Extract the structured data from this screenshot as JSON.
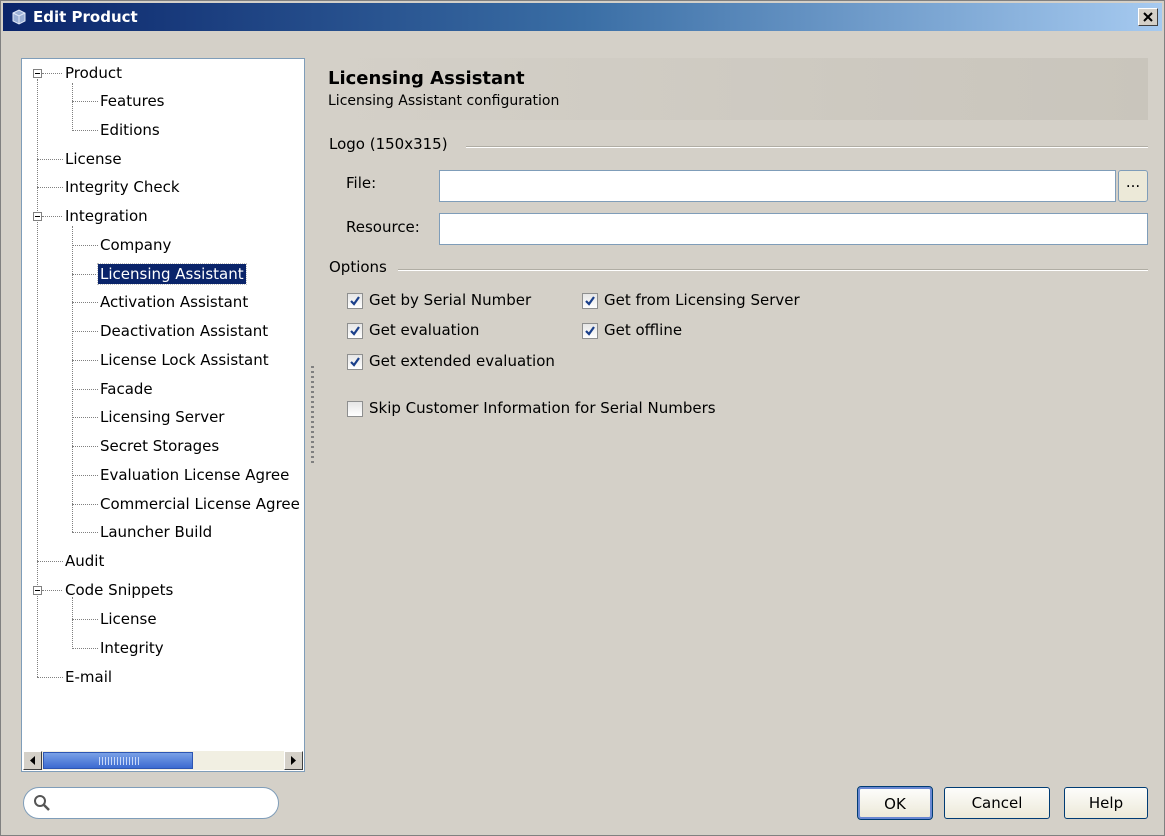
{
  "window": {
    "title": "Edit Product"
  },
  "tree": {
    "items": [
      {
        "label": "Product"
      },
      {
        "label": "Features"
      },
      {
        "label": "Editions"
      },
      {
        "label": "License"
      },
      {
        "label": "Integrity Check"
      },
      {
        "label": "Integration"
      },
      {
        "label": "Company"
      },
      {
        "label": "Licensing Assistant",
        "selected": true
      },
      {
        "label": "Activation Assistant"
      },
      {
        "label": "Deactivation Assistant"
      },
      {
        "label": "License Lock Assistant"
      },
      {
        "label": "Facade"
      },
      {
        "label": "Licensing Server"
      },
      {
        "label": "Secret Storages"
      },
      {
        "label": "Evaluation License Agree"
      },
      {
        "label": "Commercial License Agree"
      },
      {
        "label": "Launcher Build"
      },
      {
        "label": "Audit"
      },
      {
        "label": "Code Snippets"
      },
      {
        "label": "License"
      },
      {
        "label": "Integrity"
      },
      {
        "label": "E-mail"
      }
    ]
  },
  "search": {
    "value": "",
    "placeholder": ""
  },
  "panel": {
    "title": "Licensing Assistant",
    "subtitle": "Licensing Assistant configuration",
    "logo_group": "Logo (150x315)",
    "file_label": "File:",
    "file_value": "",
    "browse_label": "...",
    "resource_label": "Resource:",
    "resource_value": "",
    "options_group": "Options",
    "options": [
      {
        "label": "Get by Serial Number",
        "checked": true
      },
      {
        "label": "Get from Licensing Server",
        "checked": true
      },
      {
        "label": "Get evaluation",
        "checked": true
      },
      {
        "label": "Get offline",
        "checked": true
      },
      {
        "label": "Get extended evaluation",
        "checked": true
      },
      {
        "label": "Skip Customer Information for Serial Numbers",
        "checked": false
      }
    ]
  },
  "buttons": {
    "ok": "OK",
    "cancel": "Cancel",
    "help": "Help"
  },
  "colors": {
    "selection": "#0a246a",
    "titlebar": "#0a246a",
    "check": "#21a121"
  }
}
